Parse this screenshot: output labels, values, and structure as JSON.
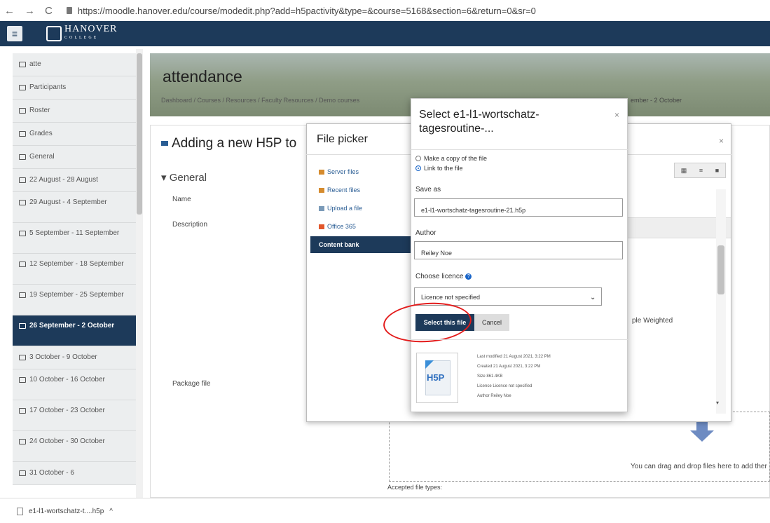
{
  "browser": {
    "back": "←",
    "forward": "→",
    "reload": "C",
    "url": "https://moodle.hanover.edu/course/modedit.php?add=h5pactivity&type=&course=5168&section=6&return=0&sr=0"
  },
  "site": {
    "menu_icon": "≡",
    "logo_name": "HANOVER",
    "logo_sub": "COLLEGE"
  },
  "sidebar": {
    "items": [
      {
        "label": "atte"
      },
      {
        "label": "Participants"
      },
      {
        "label": "Roster"
      },
      {
        "label": "Grades"
      },
      {
        "label": "General"
      },
      {
        "label": "22 August - 28 August"
      },
      {
        "label": "29 August - 4 September"
      },
      {
        "label": "5 September - 11 September"
      },
      {
        "label": "12 September - 18 September"
      },
      {
        "label": "19 September - 25 September"
      },
      {
        "label": "26 September - 2 October"
      },
      {
        "label": "3 October - 9 October"
      },
      {
        "label": "10 October - 16 October"
      },
      {
        "label": "17 October - 23 October"
      },
      {
        "label": "24 October - 30 October"
      },
      {
        "label": "31 October - 6"
      }
    ]
  },
  "page": {
    "title": "attendance",
    "breadcrumb": "Dashboard / Courses / Resources / Faculty Resources / Demo courses",
    "breadcrumb_end": "ember - 2 October",
    "heading": "Adding a new H5P to",
    "section": "General",
    "label_name": "Name",
    "label_description": "Description",
    "label_package": "Package file",
    "accepted": "Accepted file types:",
    "drop_text": "You can drag and drop files here to add ther"
  },
  "file_picker": {
    "title": "File picker",
    "close": "×",
    "repos": [
      "Server files",
      "Recent files",
      "Upload a file",
      "Office 365",
      "Content bank"
    ],
    "weighted_text": "ple Weighted"
  },
  "select_dialog": {
    "title": "Select e1-l1-wortschatz-tagesroutine-...",
    "close": "×",
    "option_copy": "Make a copy of the file",
    "option_link": "Link to the file",
    "save_as_label": "Save as",
    "save_as_value": "e1-l1-wortschatz-tagesroutine-21.h5p",
    "author_label": "Author",
    "author_value": "Reiley Noe",
    "licence_label": "Choose licence",
    "licence_value": "Licence not specified",
    "select_button": "Select this file",
    "cancel_button": "Cancel",
    "thumb_label": "H5P",
    "meta": [
      "Last modified  21 August 2021, 3:22 PM",
      "Created  21 August 2021, 3:22 PM",
      "Size  861.4KB",
      "Licence  Licence not specified",
      "Author  Reiley Noe"
    ]
  },
  "downloads": {
    "file": "e1-l1-wortschatz-t....h5p",
    "chevron": "^"
  },
  "colors": {
    "navbar": "#1d3a5a",
    "accent": "#1a66c9",
    "highlight_circle": "#e31b1b"
  }
}
